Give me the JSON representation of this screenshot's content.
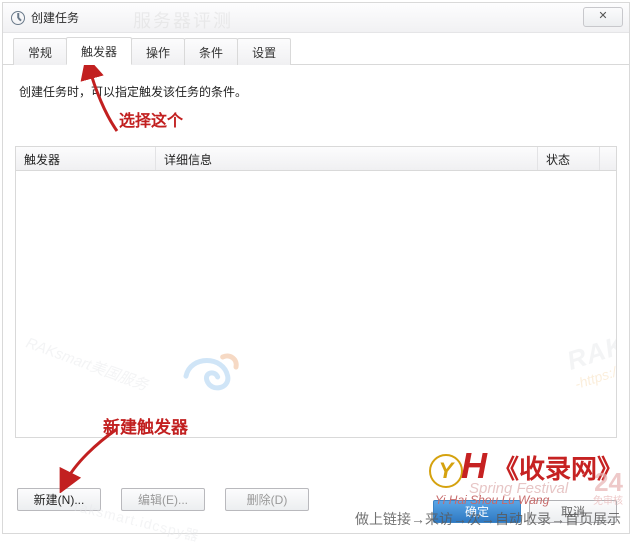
{
  "window": {
    "title": "创建任务"
  },
  "tabs": [
    {
      "label": "常规"
    },
    {
      "label": "触发器"
    },
    {
      "label": "操作"
    },
    {
      "label": "条件"
    },
    {
      "label": "设置"
    }
  ],
  "active_tab_index": 1,
  "instruction": "创建任务时，可以指定触发该任务的条件。",
  "table": {
    "columns": {
      "trigger": "触发器",
      "detail": "详细信息",
      "status": "状态"
    },
    "rows": []
  },
  "buttons": {
    "new": "新建(N)...",
    "edit": "编辑(E)...",
    "delete": "删除(D)"
  },
  "footer": {
    "ok": "确定",
    "cancel": "取消"
  },
  "annotations": {
    "select_this": "选择这个",
    "new_trigger": "新建触发器"
  },
  "watermarks": {
    "top": "服务器评测",
    "rak": "RAK",
    "rak_sub": "-https://",
    "left_diag": "RAKsmart美国服务",
    "left_bottom": "raksmart.idcspy器",
    "logo_y": "Y",
    "logo_h": "H",
    "logo_cn": "《收录网》",
    "logo_script": "Spring Festival",
    "logo_py": "Yi Hai Shou Lu Wang",
    "logo_24": "24",
    "logo_24_sub": "免审核",
    "banner": "做上链接→来访→次→自动收录→首页展示"
  }
}
